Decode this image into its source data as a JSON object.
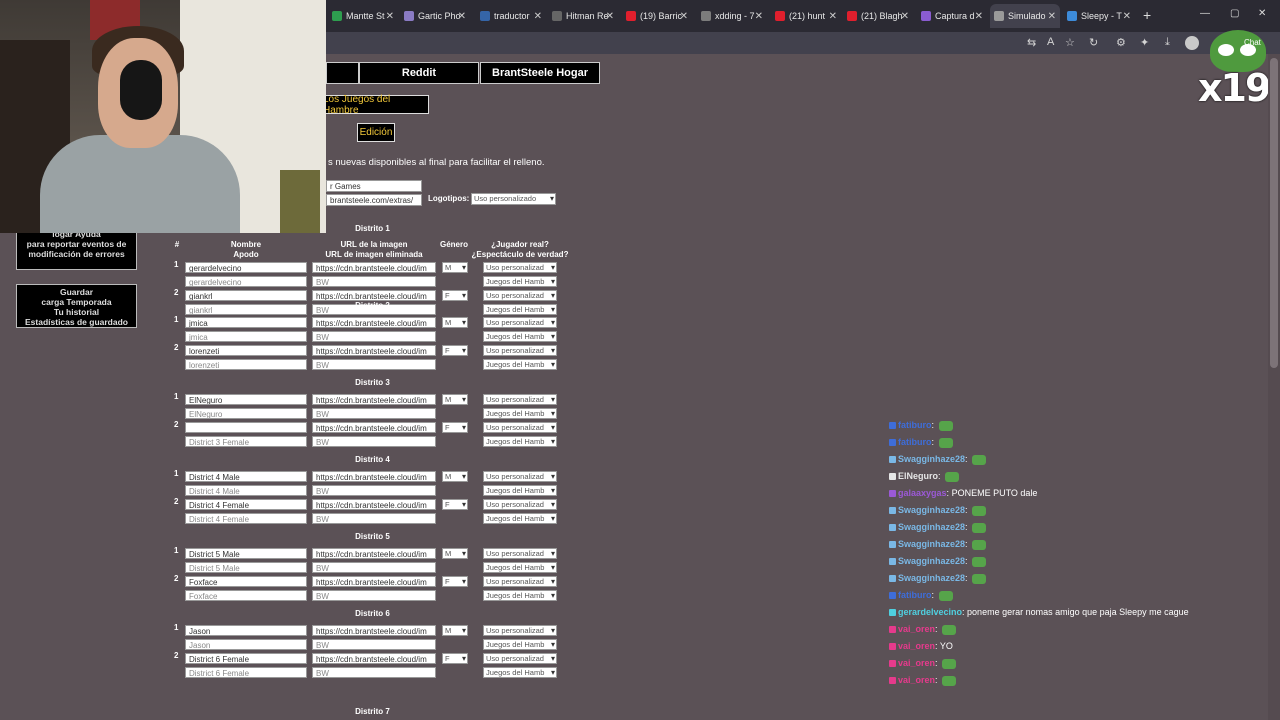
{
  "browser": {
    "tabs": [
      {
        "label": "Mantte St",
        "color": "#2e9e4f"
      },
      {
        "label": "Gartic Pho",
        "color": "#8a7bc4"
      },
      {
        "label": "traductor",
        "color": "#3565a8"
      },
      {
        "label": "Hitman Re",
        "color": "#666666"
      },
      {
        "label": "(19) Barric",
        "color": "#e01f2d"
      },
      {
        "label": "xdding - 7",
        "color": "#7c7c7c"
      },
      {
        "label": "(21) hunt",
        "color": "#e01f2d"
      },
      {
        "label": "(21) Blagh",
        "color": "#e01f2d"
      },
      {
        "label": "Captura d",
        "color": "#8a5cd0"
      },
      {
        "label": "Simulado",
        "color": "#9a9a9a"
      },
      {
        "label": "Sleepy - T",
        "color": "#3d8bd9"
      }
    ],
    "new_tab": "+",
    "window_buttons": [
      "—",
      "▢",
      "✕"
    ]
  },
  "overlay": {
    "badge_text": "x19",
    "chat_label": "Chat"
  },
  "page": {
    "nav": {
      "reddit": "Reddit",
      "home": "BrantSteele Hogar"
    },
    "title": "Los Juegos del Hambre",
    "edition": "Edición",
    "info": "s nuevas disponibles al final para facilitar el relleno.",
    "name_field": "r Games",
    "url_field": "brantsteele.com/extras/",
    "logos_label": "Logotipos:",
    "logos_value": "Uso personalizado",
    "sidebar": {
      "help_partial": "logar Ayuda",
      "help_lines": [
        "para reportar eventos de",
        "modificación de errores"
      ],
      "save_lines": [
        "Guardar",
        "carga Temporada",
        "Tu historial",
        "Estadísticas de guardado"
      ]
    },
    "headers": {
      "num": "#",
      "name": "Nombre",
      "nick": "Apodo",
      "url": "URL de la imagen",
      "url_dead": "URL de imagen eliminada",
      "gender": "Género",
      "real": "¿Jugador real?",
      "spectacle": "¿Espectáculo de verdad?"
    },
    "districts": [
      {
        "label": "Distrito 1",
        "tributes": [
          {
            "num": "1",
            "name": "gerardelvecino",
            "nick": "gerardelvecino",
            "url": "https://cdn.brantsteele.cloud/im",
            "dead": "BW",
            "gender": "M",
            "real": "Uso personalizad",
            "show": "Juegos del Hamb"
          },
          {
            "num": "2",
            "name": "giankrl",
            "nick": "giankrl",
            "url": "https://cdn.brantsteele.cloud/im",
            "dead": "BW",
            "gender": "F",
            "real": "Uso personalizad",
            "show": "Juegos del Hamb"
          }
        ]
      },
      {
        "label": "Distrito 2",
        "tributes": [
          {
            "num": "1",
            "name": "jmica",
            "nick": "jmica",
            "url": "https://cdn.brantsteele.cloud/im",
            "dead": "BW",
            "gender": "M",
            "real": "Uso personalizad",
            "show": "Juegos del Hamb"
          },
          {
            "num": "2",
            "name": "lorenzeti",
            "nick": "lorenzeti",
            "url": "https://cdn.brantsteele.cloud/im",
            "dead": "BW",
            "gender": "F",
            "real": "Uso personalizad",
            "show": "Juegos del Hamb"
          }
        ]
      },
      {
        "label": "Distrito 3",
        "tributes": [
          {
            "num": "1",
            "name": "ElNeguro",
            "nick": "ElNeguro",
            "url": "https://cdn.brantsteele.cloud/im",
            "dead": "BW",
            "gender": "M",
            "real": "Uso personalizad",
            "show": "Juegos del Hamb"
          },
          {
            "num": "2",
            "name": "",
            "nick": "District 3 Female",
            "url": "https://cdn.brantsteele.cloud/im",
            "dead": "BW",
            "gender": "F",
            "real": "Uso personalizad",
            "show": "Juegos del Hamb"
          }
        ]
      },
      {
        "label": "Distrito 4",
        "tributes": [
          {
            "num": "1",
            "name": "District 4 Male",
            "nick": "District 4 Male",
            "url": "https://cdn.brantsteele.cloud/im",
            "dead": "BW",
            "gender": "M",
            "real": "Uso personalizad",
            "show": "Juegos del Hamb"
          },
          {
            "num": "2",
            "name": "District 4 Female",
            "nick": "District 4 Female",
            "url": "https://cdn.brantsteele.cloud/im",
            "dead": "BW",
            "gender": "F",
            "real": "Uso personalizad",
            "show": "Juegos del Hamb"
          }
        ]
      },
      {
        "label": "Distrito 5",
        "tributes": [
          {
            "num": "1",
            "name": "District 5 Male",
            "nick": "District 5 Male",
            "url": "https://cdn.brantsteele.cloud/im",
            "dead": "BW",
            "gender": "M",
            "real": "Uso personalizad",
            "show": "Juegos del Hamb"
          },
          {
            "num": "2",
            "name": "Foxface",
            "nick": "Foxface",
            "url": "https://cdn.brantsteele.cloud/im",
            "dead": "BW",
            "gender": "F",
            "real": "Uso personalizad",
            "show": "Juegos del Hamb"
          }
        ]
      },
      {
        "label": "Distrito 6",
        "tributes": [
          {
            "num": "1",
            "name": "Jason",
            "nick": "Jason",
            "url": "https://cdn.brantsteele.cloud/im",
            "dead": "BW",
            "gender": "M",
            "real": "Uso personalizad",
            "show": "Juegos del Hamb"
          },
          {
            "num": "2",
            "name": "District 6 Female",
            "nick": "District 6 Female",
            "url": "https://cdn.brantsteele.cloud/im",
            "dead": "BW",
            "gender": "F",
            "real": "Uso personalizad",
            "show": "Juegos del Hamb"
          }
        ]
      }
    ],
    "next_district": "Distrito 7"
  },
  "chat": {
    "messages": [
      {
        "user": "fatiburo",
        "color": "#3e6dd9",
        "text": "",
        "emote": true
      },
      {
        "user": "fatiburo",
        "color": "#3e6dd9",
        "text": "",
        "emote": true
      },
      {
        "user": "Swagginhaze28",
        "color": "#7ab8e6",
        "text": "",
        "emote": true
      },
      {
        "user": "ElNeguro",
        "color": "#e6e6e6",
        "text": "",
        "emote": true
      },
      {
        "user": "galaaxygas",
        "color": "#9b59d6",
        "text": "PONEME PUTO dale",
        "emote": false
      },
      {
        "user": "Swagginhaze28",
        "color": "#7ab8e6",
        "text": "",
        "emote": true
      },
      {
        "user": "Swagginhaze28",
        "color": "#7ab8e6",
        "text": "",
        "emote": true
      },
      {
        "user": "Swagginhaze28",
        "color": "#7ab8e6",
        "text": "",
        "emote": true
      },
      {
        "user": "Swagginhaze28",
        "color": "#7ab8e6",
        "text": "",
        "emote": true
      },
      {
        "user": "Swagginhaze28",
        "color": "#7ab8e6",
        "text": "",
        "emote": true
      },
      {
        "user": "fatiburo",
        "color": "#3e6dd9",
        "text": "",
        "emote": true
      },
      {
        "user": "gerardelvecino",
        "color": "#4fd0e0",
        "text": "poneme gerar nomas amigo que paja Sleepy me cague",
        "emote": false
      },
      {
        "user": "vai_oren",
        "color": "#e63a8c",
        "text": "",
        "emote": true
      },
      {
        "user": "vai_oren",
        "color": "#e63a8c",
        "text": "YO",
        "emote": false
      },
      {
        "user": "vai_oren",
        "color": "#e63a8c",
        "text": "",
        "emote": true
      },
      {
        "user": "vai_oren",
        "color": "#e63a8c",
        "text": "",
        "emote": true
      }
    ]
  }
}
